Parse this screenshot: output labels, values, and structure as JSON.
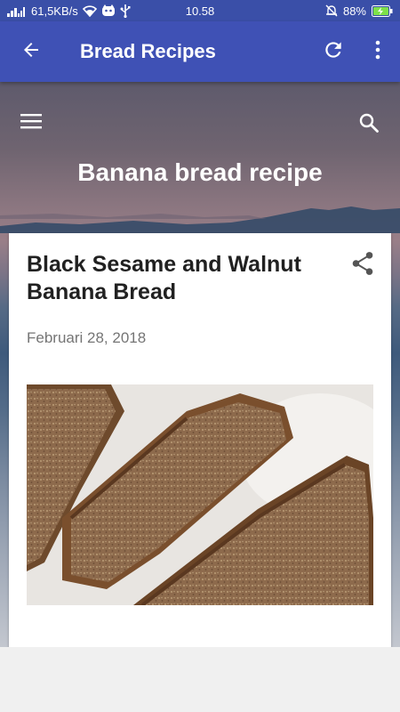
{
  "status_bar": {
    "network_speed": "61,5KB/s",
    "time": "10.58",
    "battery": "88%"
  },
  "app_bar": {
    "title": "Bread Recipes"
  },
  "blog": {
    "title": "Banana bread recipe"
  },
  "post": {
    "title": "Black Sesame and Walnut Banana Bread",
    "date": "Februari 28, 2018"
  },
  "colors": {
    "app_bar": "#3f51b5",
    "status_bar": "#3a4fa8",
    "battery_charging": "#7ee04a"
  },
  "icons": [
    "signal-icon",
    "wifi-icon",
    "notification-icon",
    "usb-icon",
    "alarm-off-icon",
    "battery-charging-icon",
    "back-arrow-icon",
    "refresh-icon",
    "more-vert-icon",
    "menu-icon",
    "search-icon",
    "share-icon"
  ]
}
